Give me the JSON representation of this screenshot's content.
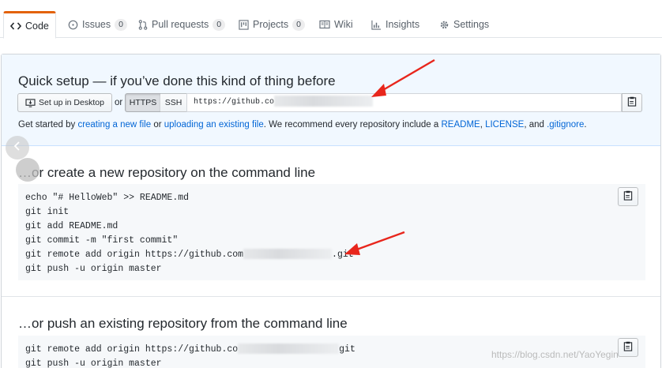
{
  "tabs": [
    {
      "label": "Code",
      "icon": "code-icon",
      "selected": true
    },
    {
      "label": "Issues",
      "icon": "issue-opened-icon",
      "count": "0"
    },
    {
      "label": "Pull requests",
      "icon": "git-pull-request-icon",
      "count": "0"
    },
    {
      "label": "Projects",
      "icon": "project-icon",
      "count": "0"
    },
    {
      "label": "Wiki",
      "icon": "book-icon"
    },
    {
      "label": "Insights",
      "icon": "graph-icon"
    },
    {
      "label": "Settings",
      "icon": "gear-icon"
    }
  ],
  "quick_setup": {
    "title": "Quick setup — if you’ve done this kind of thing before",
    "desktop_button": "Set up in Desktop",
    "or": "or",
    "https": "HTTPS",
    "ssh": "SSH",
    "url": "https://github.co",
    "get_started_prefix": "Get started by ",
    "link_new_file": "creating a new file",
    "or_word": " or ",
    "link_upload": "uploading an existing file",
    "recommend": ". We recommend every repository include a ",
    "link_readme": "README",
    "comma": ", ",
    "link_license": "LICENSE",
    "and_word": ", and ",
    "link_gitignore": ".gitignore",
    "period": "."
  },
  "create_section": {
    "title": "…or create a new repository on the command line",
    "lines": [
      "echo \"# HelloWeb\" >> README.md",
      "git init",
      "git add README.md",
      "git commit -m \"first commit\"",
      "git remote add origin https://github.com",
      "git push -u origin master"
    ],
    "remote_suffix": ".git"
  },
  "push_section": {
    "title": "…or push an existing repository from the command line",
    "line1_prefix": "git remote add origin https://github.co",
    "line1_suffix": "git",
    "line2": "git push -u origin master"
  },
  "watermark": "https://blog.csdn.net/YaoYegin",
  "colors": {
    "accent_orange": "#e36209",
    "link_blue": "#0366d6",
    "annotation_red": "#e8261c",
    "quick_bg": "#f1f8ff"
  }
}
